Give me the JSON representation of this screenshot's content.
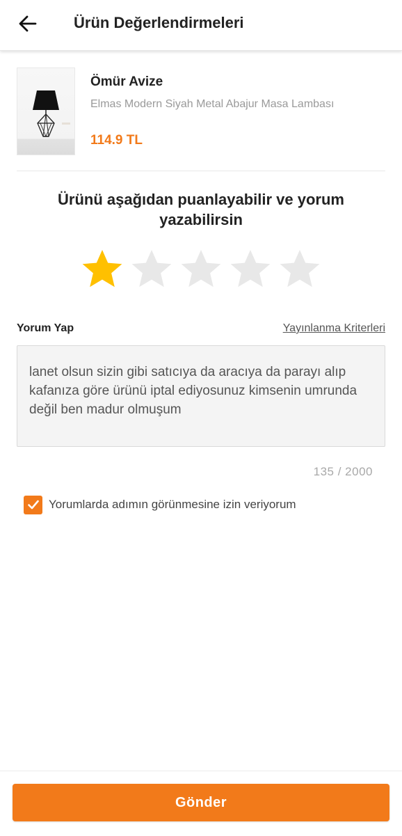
{
  "header": {
    "title": "Ürün Değerlendirmeleri",
    "back_icon": "arrow-left-icon"
  },
  "product": {
    "brand": "Ömür Avize",
    "name": "Elmas Modern Siyah Metal Abajur Masa Lambası",
    "price": "114.9 TL",
    "image_icon": "table-lamp-image"
  },
  "rating": {
    "prompt": "Ürünü aşağıdan puanlayabilir ve yorum yazabilirsin",
    "value": 1,
    "max": 5,
    "filled_color": "#FFC000",
    "empty_color": "#E8E8E8"
  },
  "comment": {
    "label": "Yorum Yap",
    "criteria_link": "Yayınlanma Kriterleri",
    "text": "lanet olsun sizin gibi satıcıya da aracıya da parayı alıp kafanıza göre ürünü iptal ediyosunuz kimsenin umrunda değil ben madur olmuşum",
    "counter": "135 / 2000"
  },
  "consent": {
    "checked": true,
    "label": "Yorumlarda adımın görünmesine izin veriyorum"
  },
  "submit": {
    "label": "Gönder"
  },
  "colors": {
    "accent": "#F27A1A",
    "star_filled": "#FFC000"
  }
}
